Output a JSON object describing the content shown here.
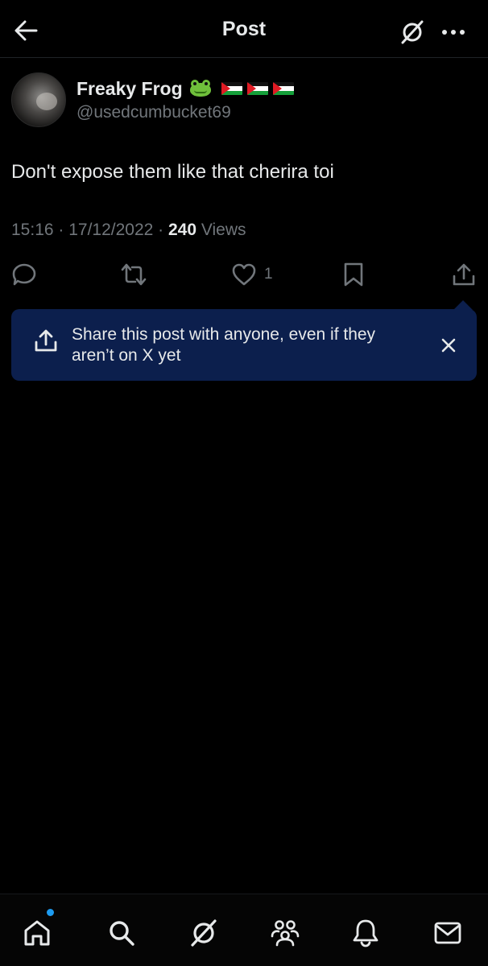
{
  "header": {
    "title": "Post",
    "back_icon": "arrow-left-icon",
    "grok_icon": "grok-icon",
    "more_icon": "more-dots-icon"
  },
  "post": {
    "display_name": "Freaky Frog",
    "handle": "@usedcumbucket69",
    "text": "Don't expose them like that cherira toi",
    "time": "15:16 · 17/12/2022 · ",
    "views_count": "240",
    "views_label": " Views"
  },
  "actions": {
    "reply_icon": "reply-icon",
    "repost_icon": "repost-icon",
    "like_icon": "heart-icon",
    "like_count": "1",
    "bookmark_icon": "bookmark-icon",
    "share_icon": "share-icon"
  },
  "tooltip": {
    "text": "Share this post with anyone, even if they aren’t on X yet",
    "icon": "share-icon",
    "close_icon": "close-icon"
  },
  "bottom_nav": {
    "items": [
      "home-icon",
      "search-icon",
      "grok-icon",
      "communities-icon",
      "notifications-icon",
      "messages-icon"
    ]
  },
  "colors": {
    "background": "#000000",
    "text": "#e7e9ea",
    "muted": "#71767b",
    "tooltip_bg": "#0c1f4d",
    "accent": "#1d9bf0"
  }
}
